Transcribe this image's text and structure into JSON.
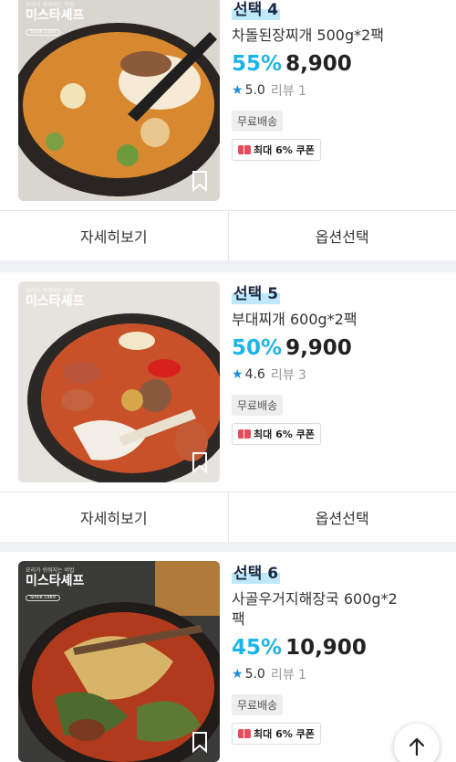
{
  "products": [
    {
      "tag": "선택 4",
      "title": "차돌된장찌개 500g*2팩",
      "discount": "55%",
      "price": "8,900",
      "rating": "5.0",
      "reviews": "리뷰 1",
      "shipping": "무료배송",
      "coupon": "최대 6% 쿠폰",
      "brand": "미스타셰프",
      "brand_small": "요리가 쉬워지는 비법",
      "brand_since": "Since 1989",
      "detail_label": "자세히보기",
      "option_label": "옵션선택"
    },
    {
      "tag": "선택 5",
      "title": "부대찌개 600g*2팩",
      "discount": "50%",
      "price": "9,900",
      "rating": "4.6",
      "reviews": "리뷰 3",
      "shipping": "무료배송",
      "coupon": "최대 6% 쿠폰",
      "brand": "미스타셰프",
      "brand_small": "요리가 쉬워지는 비법",
      "detail_label": "자세히보기",
      "option_label": "옵션선택"
    },
    {
      "tag": "선택 6",
      "title": "사골우거지해장국 600g*2",
      "title_line2": "팩",
      "discount": "45%",
      "price": "10,900",
      "rating": "5.0",
      "reviews": "리뷰 1",
      "shipping": "무료배송",
      "coupon": "최대 6% 쿠폰",
      "brand": "미스타셰프",
      "brand_small": "요리가 쉬워지는 비법",
      "brand_since": "Since 1989"
    }
  ],
  "icons": {
    "star": "star-icon",
    "bookmark": "bookmark-icon",
    "coupon": "coupon-icon",
    "scroll_top": "arrow-up-icon"
  },
  "colors": {
    "discount": "#1db4e8",
    "tag_highlight": "#bfe9fb",
    "star": "#1b8fd6",
    "coupon": "#e84c5a"
  }
}
